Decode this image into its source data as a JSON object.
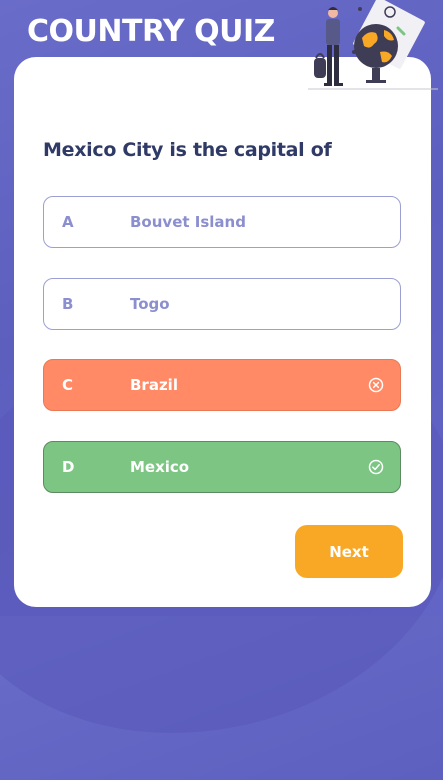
{
  "app": {
    "title": "COUNTRY QUIZ"
  },
  "question": {
    "text": "Mexico City is the capital of"
  },
  "options": [
    {
      "letter": "A",
      "text": "Bouvet Island",
      "state": "neutral"
    },
    {
      "letter": "B",
      "text": "Togo",
      "state": "neutral"
    },
    {
      "letter": "C",
      "text": "Brazil",
      "state": "wrong",
      "icon": "x-circle-icon"
    },
    {
      "letter": "D",
      "text": "Mexico",
      "state": "correct",
      "icon": "check-circle-icon"
    }
  ],
  "actions": {
    "next_label": "Next"
  },
  "colors": {
    "background": "#6264c6",
    "title": "#ffffff",
    "question": "#2f3a66",
    "neutral_text": "#8b8fcf",
    "wrong": "#ff8a65",
    "correct": "#7cc583",
    "accent": "#f9a826"
  },
  "icons": {
    "illustration": "traveler-with-globe-illustration"
  }
}
